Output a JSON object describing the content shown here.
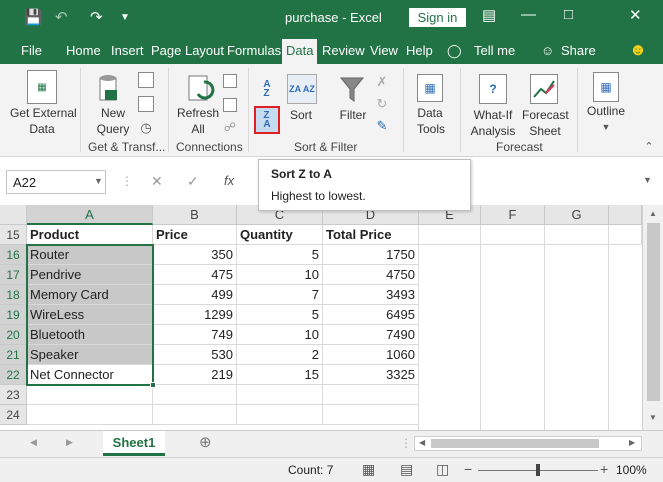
{
  "title": "purchase - Excel",
  "signin": "Sign in",
  "tabs": [
    "File",
    "Home",
    "Insert",
    "Page Layout",
    "Formulas",
    "Data",
    "Review",
    "View",
    "Help",
    "Tell me",
    "Share"
  ],
  "ribbon": {
    "get_external": [
      "Get External",
      "Data"
    ],
    "new_query": [
      "New",
      "Query"
    ],
    "refresh": [
      "Refresh",
      "All"
    ],
    "sort": "Sort",
    "filter": "Filter",
    "data_tools": [
      "Data",
      "Tools"
    ],
    "whatif": [
      "What-If",
      "Analysis"
    ],
    "forecast_sheet": [
      "Forecast",
      "Sheet"
    ],
    "outline": "Outline",
    "groups": [
      "Get & Transf...",
      "Connections",
      "Sort & Filter",
      "Forecast"
    ]
  },
  "namebox": "A22",
  "tooltip": {
    "title": "Sort Z to A",
    "body": "Highest to lowest."
  },
  "columns": [
    "A",
    "B",
    "C",
    "D",
    "E",
    "F",
    "G"
  ],
  "row_numbers": [
    "15",
    "16",
    "17",
    "18",
    "19",
    "20",
    "21",
    "22",
    "23",
    "24"
  ],
  "headers": [
    "Product",
    "Price",
    "Quantity",
    "Total Price"
  ],
  "rows": [
    [
      "Router",
      "350",
      "5",
      "1750"
    ],
    [
      "Pendrive",
      "475",
      "10",
      "4750"
    ],
    [
      "Memory Card",
      "499",
      "7",
      "3493"
    ],
    [
      "WireLess",
      "1299",
      "5",
      "6495"
    ],
    [
      "Bluetooth",
      "749",
      "10",
      "7490"
    ],
    [
      "Speaker",
      "530",
      "2",
      "1060"
    ],
    [
      "Net Connector",
      "219",
      "15",
      "3325"
    ]
  ],
  "sheet_tab": "Sheet1",
  "status": {
    "count": "Count: 7",
    "zoom": "100%"
  },
  "colors": {
    "accent": "#217346",
    "select": "#c8c8c8",
    "red_box": "#e02020"
  }
}
